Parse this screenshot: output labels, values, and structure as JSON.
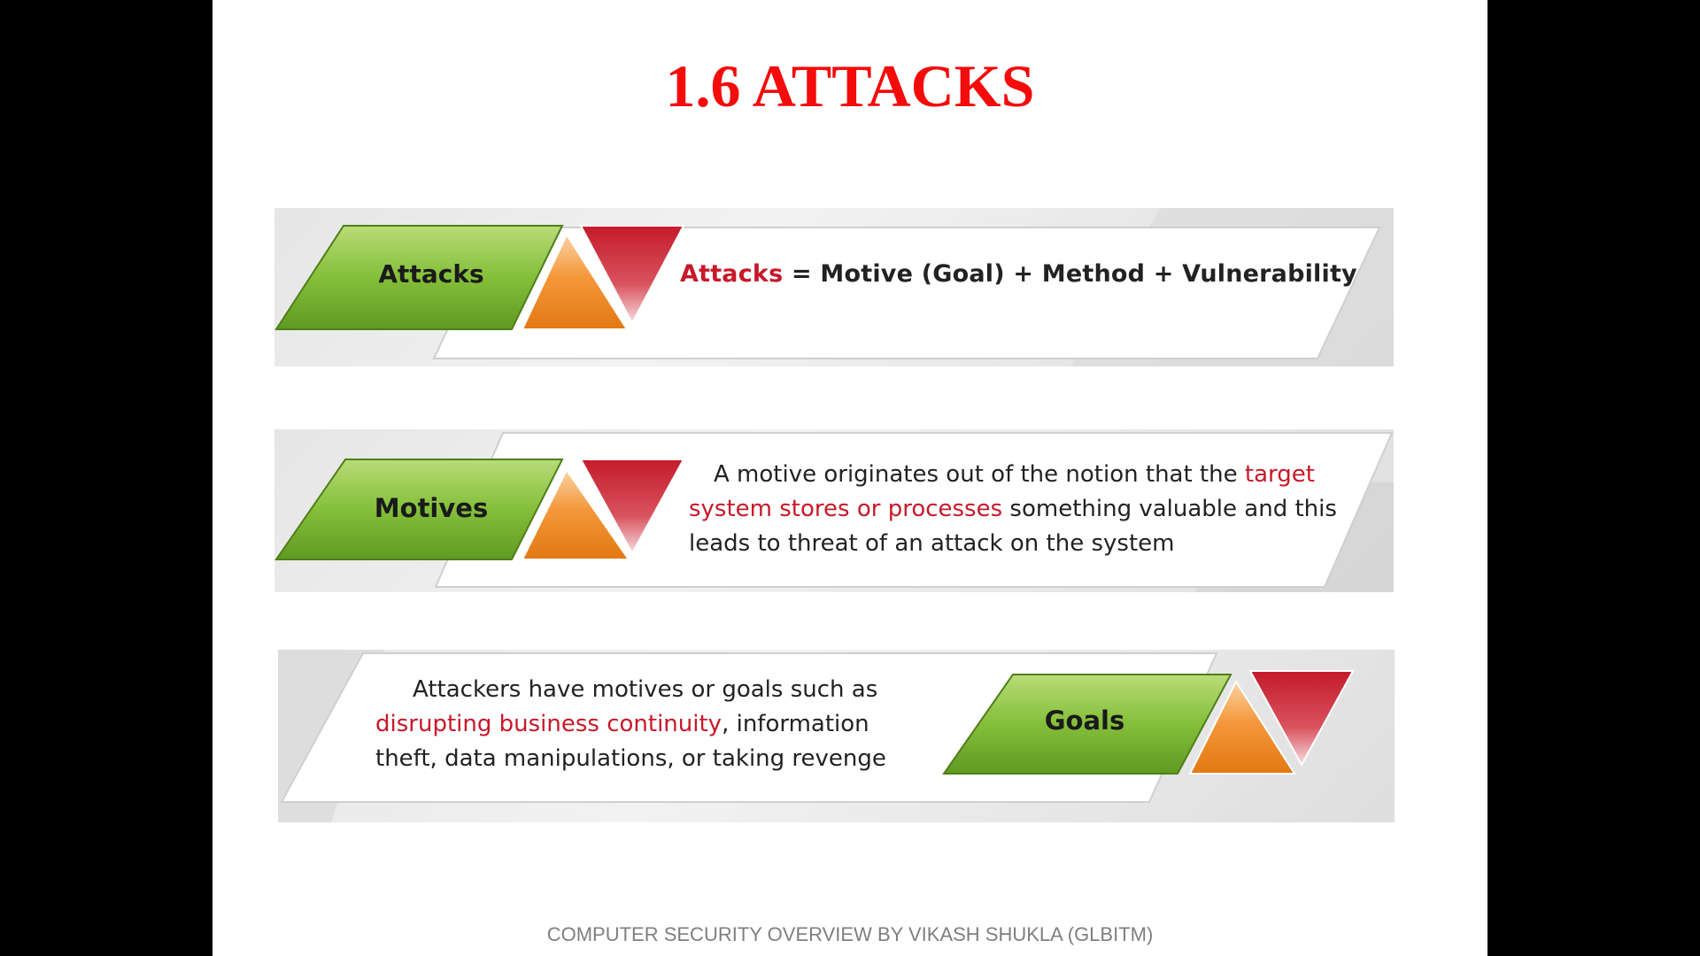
{
  "slide": {
    "title": "1.6 ATTACKS",
    "footer": "COMPUTER SECURITY OVERVIEW BY VIKASH SHUKLA (GLBITM)"
  },
  "banners": {
    "attacks": {
      "label": "Attacks",
      "formula_highlight": "Attacks",
      "formula_rest": " = Motive (Goal) + Method + Vulnerability"
    },
    "motives": {
      "label": "Motives",
      "text_part1": "A motive originates out of the notion that the ",
      "text_highlight": "target system stores or processes",
      "text_part2": " something valuable and this leads to threat of an attack on the system"
    },
    "goals": {
      "label": "Goals",
      "text_part1": "Attackers have motives or goals such as ",
      "text_highlight": "disrupting business continuity",
      "text_part2": ", information theft, data manipulations, or taking revenge"
    }
  },
  "colors": {
    "title": "#f40b0b",
    "highlight": "#c7192a",
    "green": "#7cb82f",
    "orange": "#ef8a1e",
    "red_triangle": "#c91f2e"
  }
}
